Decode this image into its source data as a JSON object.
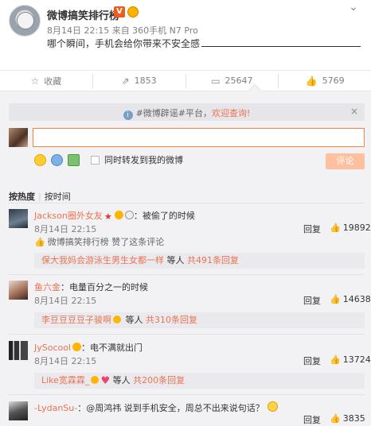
{
  "post": {
    "username": "微博搞笑排行榜",
    "v_badge": "V",
    "meta": "8月14日 22:15 来自 360手机 N7 Pro",
    "text": "哪个瞬间，手机会给你带来不安全感",
    "icons": {
      "expand": "chevron-down-icon"
    }
  },
  "actions": {
    "favorite": "收藏",
    "repost": "1853",
    "comment": "25647",
    "like": "5769"
  },
  "notice": {
    "tag": "#微博辟谣#平台，",
    "highlight": "欢迎查询!",
    "close": "×"
  },
  "composer": {
    "input_value": "",
    "repost_label": "同时转发到我的微博",
    "submit": "评论"
  },
  "sort": {
    "hot": "按热度",
    "time": "按时间"
  },
  "comments": [
    {
      "nick": "Jackson圈外女友",
      "text": "：被偷了的时候",
      "time": "8月14日 22:15",
      "reply": "回复",
      "likes": "19892",
      "liked_by": "微博搞笑排行榜 赞了这条评论",
      "sub_nick": "保大我妈会游泳生男生女都一样",
      "sub_mid": " 等人 ",
      "sub_link": "共491条回复"
    },
    {
      "nick": "鱼六金",
      "text": "：电量百分之一的时候",
      "time": "8月14日 22:15",
      "reply": "回复",
      "likes": "14638",
      "sub_nick": "李豆豆豆豆子骏啊",
      "sub_mid": " 等人 ",
      "sub_link": "共310条回复"
    },
    {
      "nick": "JySocool",
      "text": "：电不满就出门",
      "time": "8月14日 22:15",
      "reply": "回复",
      "likes": "13724",
      "sub_nick": "Like宽霖霖_",
      "sub_mid": " 等人 ",
      "sub_link": "共200条回复"
    },
    {
      "nick": "-LydanSu-",
      "text": "：@周鸿祎 说到手机安全，周总不出来说句话？",
      "time": "",
      "reply": "回复",
      "likes": "3835"
    }
  ],
  "colors": {
    "accent": "#eb7350",
    "input_border": "#ff8140",
    "submit_bg": "#ffc09f"
  }
}
